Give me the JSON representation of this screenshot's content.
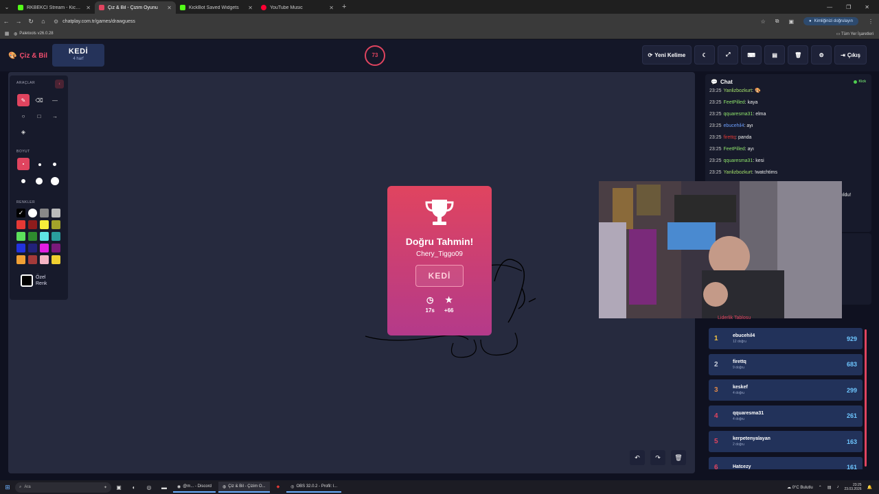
{
  "browser": {
    "tabs": [
      {
        "title": "RKBEKCI Stream - Kick Dashbo",
        "color": "#53fc18",
        "active": false
      },
      {
        "title": "Çiz & Bil - Çizim Oyunu",
        "color": "#e0445f",
        "active": true
      },
      {
        "title": "KickBot Saved Widgets",
        "color": "#53fc18",
        "active": false
      },
      {
        "title": "YouTube Music",
        "color": "#ff0033",
        "active": false
      }
    ],
    "url": "chatplay.com.tr/games/drawguess",
    "verify_label": "Kimliğinizi doğrulayın",
    "bookmark": "Paletools v26.0.28",
    "all_bookmarks": "Tüm Yer İşaretleri"
  },
  "header": {
    "logo": "Çiz & Bil",
    "word": "KEDİ",
    "word_hint": "4 harf",
    "timer": "73",
    "new_word": "Yeni Kelime",
    "exit": "Çıkış"
  },
  "tools": {
    "tools_heading": "ARAÇLAR",
    "size_heading": "BOYUT",
    "colors_heading": "RENKLER",
    "custom_color": "Özel Renk",
    "swatches": [
      "#000000",
      "#ffffff",
      "#888888",
      "#bbbbbb",
      "#e53935",
      "#8e1c1c",
      "#f5ee3a",
      "#a3a32a",
      "#5ce15c",
      "#2e8b2e",
      "#5fe3e3",
      "#2a9d9d",
      "#2233dd",
      "#22227a",
      "#e21ee2",
      "#7a1a7a",
      "#f0a035",
      "#a33a3a",
      "#f4b4c4",
      "#f0d030"
    ]
  },
  "card": {
    "title": "Doğru Tahmin!",
    "player": "Chery_Tiggo09",
    "word": "KEDİ",
    "time": "17s",
    "points": "+66"
  },
  "chat": {
    "title": "Chat",
    "platform": "Kick",
    "messages": [
      {
        "time": "23:25",
        "user": "Yanlizbozkurt",
        "color": "#a6e36b",
        "text": "🎨"
      },
      {
        "time": "23:25",
        "user": "FeetPilled",
        "color": "#8ee36b",
        "text": "kaya"
      },
      {
        "time": "23:25",
        "user": "qquaresma31",
        "color": "#8ee36b",
        "text": "elma"
      },
      {
        "time": "23:25",
        "user": "ebucehil4",
        "color": "#6ea0ff",
        "text": "ayı"
      },
      {
        "time": "23:25",
        "user": "firettq",
        "color": "#e53935",
        "text": "panda"
      },
      {
        "time": "23:25",
        "user": "FeetPilled",
        "color": "#8ee36b",
        "text": "ayı"
      },
      {
        "time": "23:25",
        "user": "qquaresma31",
        "color": "#8ee36b",
        "text": "kesi"
      },
      {
        "time": "23:25",
        "user": "Yanlizbozkurt",
        "color": "#a6e36b",
        "text": "!watchtims"
      }
    ],
    "partial": "ıldu!"
  },
  "leaderboard": {
    "title": "Liderlik Tablosu",
    "rows": [
      {
        "rank": "1",
        "name": "ebucehil4",
        "sub": "12 doğru",
        "score": "929",
        "rank_color": "#f5c542"
      },
      {
        "rank": "2",
        "name": "firettq",
        "sub": "9 doğru",
        "score": "683",
        "rank_color": "#c9cfdb"
      },
      {
        "rank": "3",
        "name": "keskef",
        "sub": "4 doğru",
        "score": "299",
        "rank_color": "#e0884a"
      },
      {
        "rank": "4",
        "name": "qquaresma31",
        "sub": "4 doğru",
        "score": "261",
        "rank_color": "#e0445f"
      },
      {
        "rank": "5",
        "name": "kerpetenyalayan",
        "sub": "2 doğru",
        "score": "163",
        "rank_color": "#e0445f"
      },
      {
        "rank": "6",
        "name": "Hatcezy",
        "sub": "",
        "score": "161",
        "rank_color": "#e0445f"
      }
    ]
  },
  "taskbar": {
    "search": "Ara",
    "apps": [
      {
        "label": "@m... - Discord",
        "active": false
      },
      {
        "label": "Çiz & Bil - Çizim O...",
        "active": true
      },
      {
        "label": "",
        "active": false
      },
      {
        "label": "OBS 32.0.2 - Profil: l...",
        "active": false
      }
    ],
    "weather": "0°C  Bulutlu",
    "time": "23:25",
    "date": "23.03.2026"
  }
}
